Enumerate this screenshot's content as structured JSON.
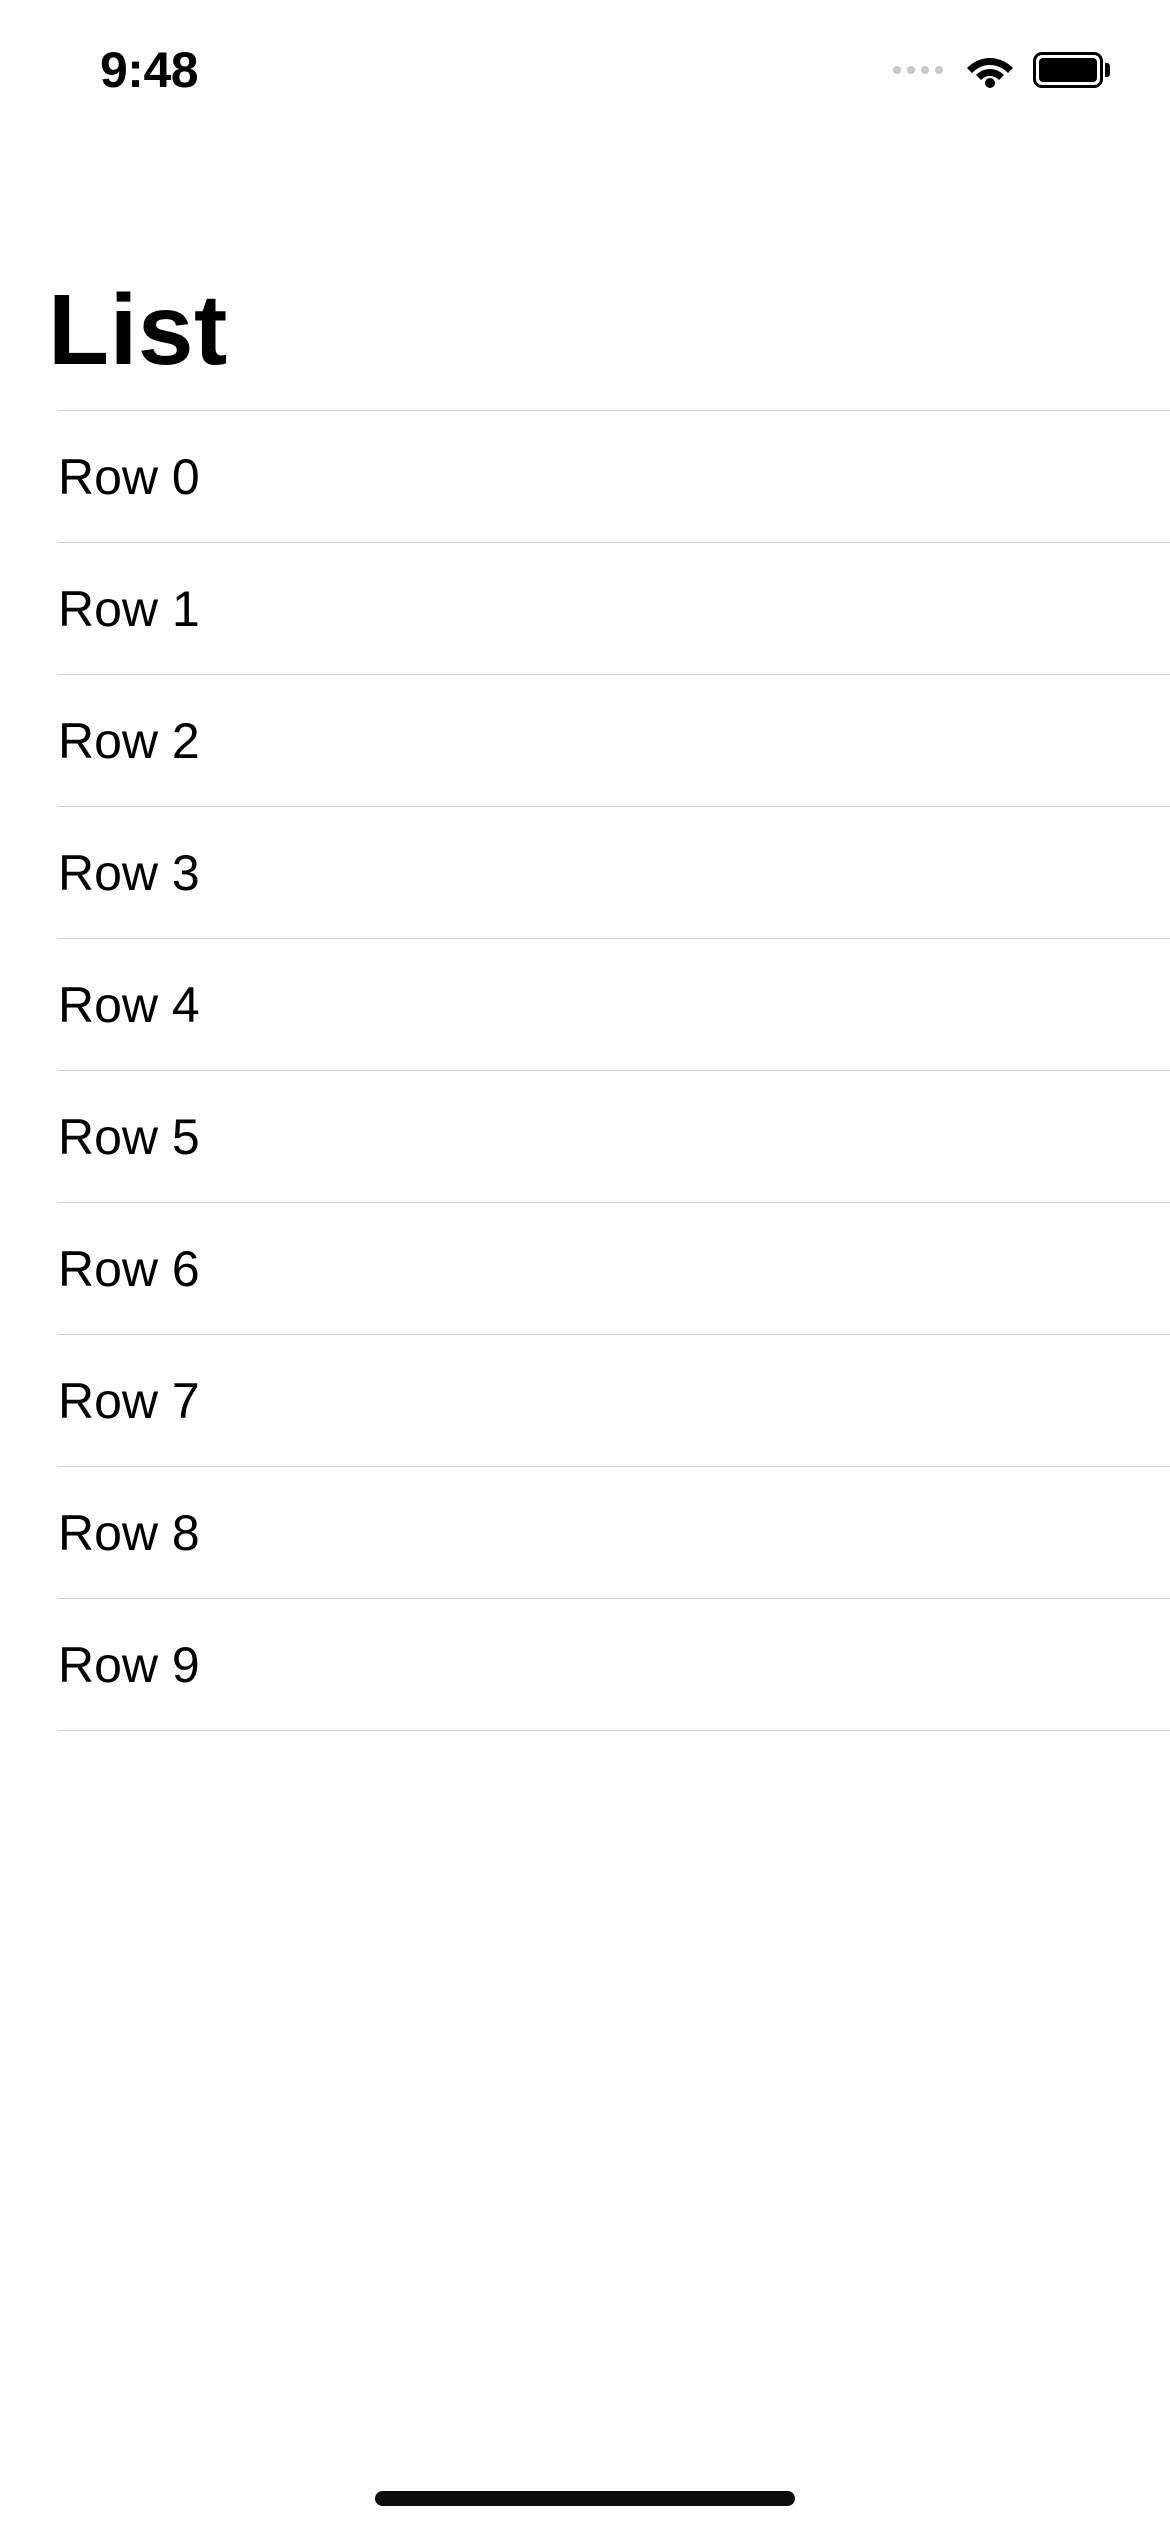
{
  "statusBar": {
    "time": "9:48"
  },
  "page": {
    "title": "List"
  },
  "list": {
    "rows": [
      {
        "label": "Row 0"
      },
      {
        "label": "Row 1"
      },
      {
        "label": "Row 2"
      },
      {
        "label": "Row 3"
      },
      {
        "label": "Row 4"
      },
      {
        "label": "Row 5"
      },
      {
        "label": "Row 6"
      },
      {
        "label": "Row 7"
      },
      {
        "label": "Row 8"
      },
      {
        "label": "Row 9"
      }
    ]
  }
}
